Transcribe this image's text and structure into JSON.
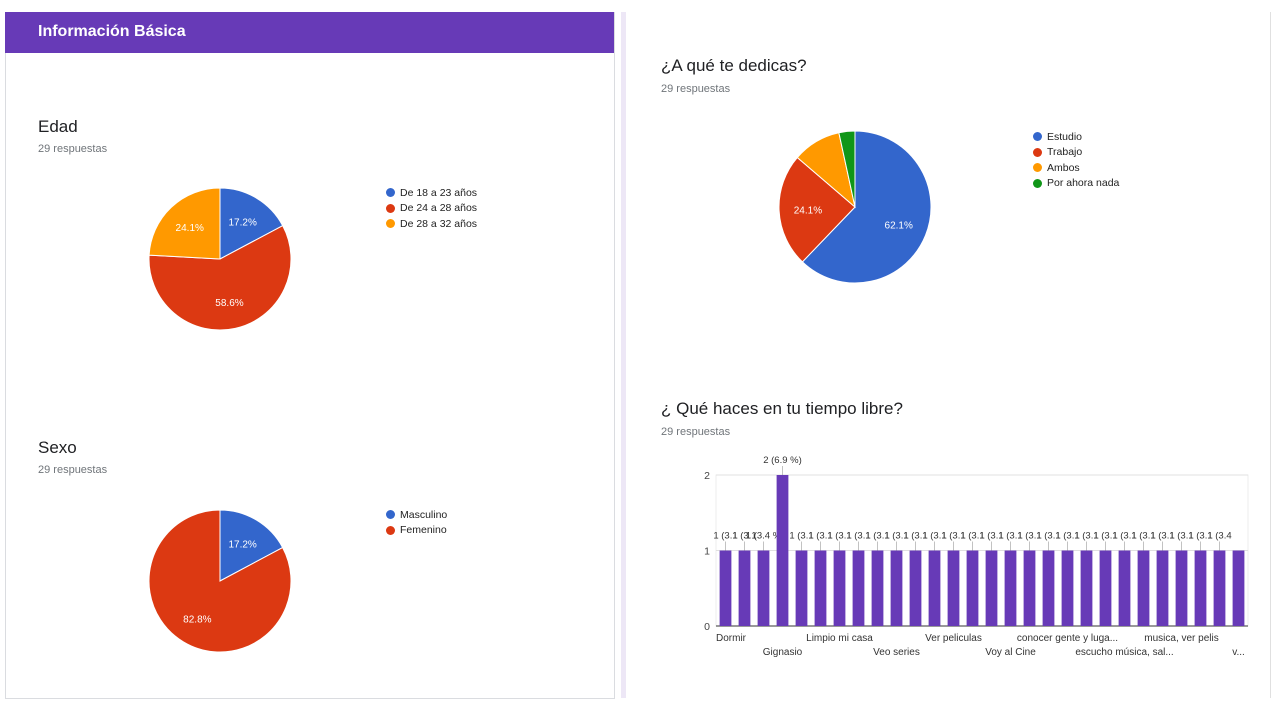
{
  "header": {
    "title": "Información Básica"
  },
  "colors": {
    "blue": "#3366cc",
    "red": "#dc3912",
    "orange": "#ff9900",
    "green": "#109618",
    "purple": "#673ab7"
  },
  "questions": {
    "edad": {
      "title": "Edad",
      "count": "29 respuestas",
      "chart_data": {
        "type": "pie",
        "title": "Edad",
        "labels": [
          "De 18 a 23 años",
          "De 24 a 28 años",
          "De 28 a 32 años"
        ],
        "values": [
          17.2,
          58.6,
          24.1
        ],
        "data_labels": [
          "17.2%",
          "58.6%",
          "24.1%"
        ],
        "colors": [
          "#3366cc",
          "#dc3912",
          "#ff9900"
        ],
        "legend": "right"
      }
    },
    "sexo": {
      "title": "Sexo",
      "count": "29 respuestas",
      "chart_data": {
        "type": "pie",
        "title": "Sexo",
        "labels": [
          "Masculino",
          "Femenino"
        ],
        "values": [
          17.2,
          82.8
        ],
        "data_labels": [
          "17.2%",
          "82.8%"
        ],
        "colors": [
          "#3366cc",
          "#dc3912"
        ],
        "legend": "right"
      }
    },
    "dedicas": {
      "title": "¿A qué te dedicas?",
      "count": "29 respuestas",
      "chart_data": {
        "type": "pie",
        "title": "¿A qué te dedicas?",
        "labels": [
          "Estudio",
          "Trabajo",
          "Ambos",
          "Por ahora nada"
        ],
        "values": [
          62.1,
          24.1,
          10.3,
          3.4
        ],
        "data_labels": [
          "62.1%",
          "24.1%",
          "",
          ""
        ],
        "colors": [
          "#3366cc",
          "#dc3912",
          "#ff9900",
          "#109618"
        ],
        "legend": "right"
      }
    },
    "tiempo": {
      "title": "¿ Qué haces en tu tiempo libre?",
      "count": "29 respuestas",
      "chart_data": {
        "type": "bar",
        "title": "¿ Qué haces en tu tiempo libre?",
        "values": [
          1,
          1,
          1,
          2,
          1,
          1,
          1,
          1,
          1,
          1,
          1,
          1,
          1,
          1,
          1,
          1,
          1,
          1,
          1,
          1,
          1,
          1,
          1,
          1,
          1,
          1,
          1,
          1
        ],
        "data_labels": [
          "1 (3.1",
          "1 (3.1",
          "1 (3.4 %",
          "2 (6.9 %)",
          "1 (3.1",
          "1 (3.1",
          "1 (3.1",
          "1 (3.1",
          "1 (3.1",
          "1 (3.1",
          "1 (3.1",
          "1 (3.1",
          "1 (3.1",
          "1 (3.1",
          "1 (3.1",
          "1 (3.1",
          "1 (3.1",
          "1 (3.1",
          "1 (3.1",
          "1 (3.1",
          "1 (3.1",
          "1 (3.1",
          "1 (3.1",
          "1 (3.1",
          "1 (3.1",
          "1 (3.1",
          "1 (3.4",
          ""
        ],
        "x_tick_labels": [
          {
            "index": 0,
            "text": "Dormir",
            "row": 0
          },
          {
            "index": 3,
            "text": "Gignasio",
            "row": 1
          },
          {
            "index": 6,
            "text": "Limpio mi casa",
            "row": 0
          },
          {
            "index": 9,
            "text": "Veo series",
            "row": 1
          },
          {
            "index": 12,
            "text": "Ver peliculas",
            "row": 0
          },
          {
            "index": 15,
            "text": "Voy al Cine",
            "row": 1
          },
          {
            "index": 18,
            "text": "conocer gente y luga...",
            "row": 0
          },
          {
            "index": 21,
            "text": "escucho música, sal...",
            "row": 1
          },
          {
            "index": 24,
            "text": "musica, ver pelis",
            "row": 0
          },
          {
            "index": 27,
            "text": "v...",
            "row": 1
          }
        ],
        "y_ticks": [
          0,
          1,
          2
        ],
        "ylim": [
          0,
          2
        ],
        "color": "#673ab7",
        "grid": true
      }
    }
  }
}
